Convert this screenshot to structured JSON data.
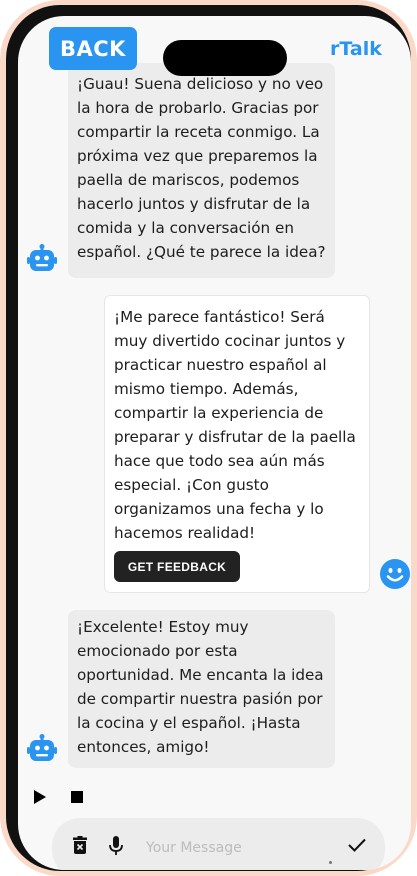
{
  "header": {
    "back_label": "BACK",
    "brand": "rTalk"
  },
  "messages": [
    {
      "sender": "bot",
      "text": "¡Guau! Suena delicioso y no veo la hora de probarlo. Gracias por compartir la receta conmigo. La próxima vez que preparemos la paella de mariscos, podemos hacerlo juntos y disfrutar de la comida y la conversación en español. ¿Qué te parece la idea?"
    },
    {
      "sender": "user",
      "text": "¡Me parece fantástico! Será muy divertido cocinar juntos y practicar nuestro español al mismo tiempo. Además, compartir la experiencia de preparar y disfrutar de la paella hace que todo sea aún más especial. ¡Con gusto organizamos una fecha y lo hacemos realidad!",
      "feedback_label": "GET FEEDBACK"
    },
    {
      "sender": "bot",
      "text": "¡Excelente! Estoy muy emocionado por esta oportunidad. Me encanta la idea de compartir nuestra pasión por la cocina y el español. ¡Hasta entonces, amigo!"
    }
  ],
  "composer": {
    "placeholder": "Your Message",
    "value": ""
  },
  "icons": {
    "bot_avatar": "robot-icon",
    "user_avatar": "smiley-icon",
    "play": "play-icon",
    "stop": "stop-icon",
    "delete": "trash-icon",
    "mic": "microphone-icon",
    "send": "checkmark-icon"
  },
  "colors": {
    "accent": "#2a95f0",
    "bot_bubble": "#ececec",
    "user_bubble": "#ffffff",
    "feedback_button": "#222222",
    "phone_frame": "#fbd9c9"
  }
}
